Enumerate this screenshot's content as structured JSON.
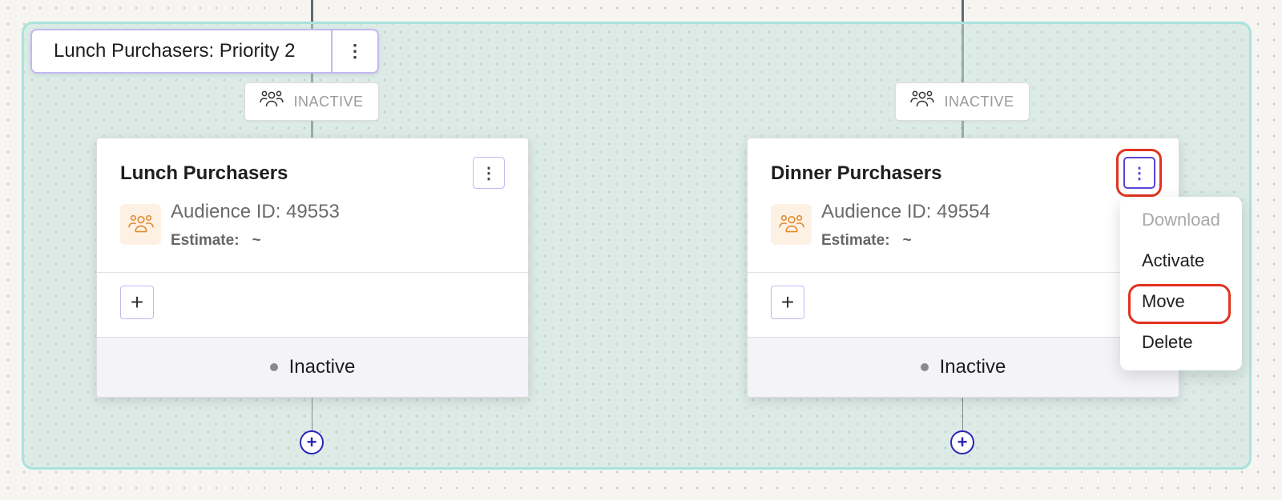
{
  "group": {
    "title": "Lunch Purchasers: Priority 2",
    "menu_glyph": "⋮"
  },
  "nodes": [
    {
      "status_chip": "INACTIVE",
      "title": "Lunch Purchasers",
      "menu_glyph": "⋮",
      "audience_id": "Audience ID: 49553",
      "estimate_label": "Estimate:",
      "estimate_value": "~",
      "add_glyph": "+",
      "status": "Inactive"
    },
    {
      "status_chip": "INACTIVE",
      "title": "Dinner Purchasers",
      "menu_glyph": "⋮",
      "audience_id": "Audience ID: 49554",
      "estimate_label": "Estimate:",
      "estimate_value": "~",
      "add_glyph": "+",
      "status": "Inactive"
    }
  ],
  "add_node_glyph": "+",
  "dropdown": {
    "items": [
      {
        "label": "Download",
        "disabled": true
      },
      {
        "label": "Activate",
        "disabled": false
      },
      {
        "label": "Move",
        "disabled": false,
        "highlighted": true
      },
      {
        "label": "Delete",
        "disabled": false
      }
    ]
  },
  "colors": {
    "group_border": "#a9e3dc",
    "accent_purple": "#5a46d6",
    "highlight_red": "#e1331f",
    "add_blue": "#2a24b8",
    "audience_icon": "#e08a2e"
  },
  "icons": {
    "status_chip": "people-group-icon",
    "audience": "people-group-icon",
    "menu": "vertical-dots-icon",
    "add": "plus-icon"
  }
}
